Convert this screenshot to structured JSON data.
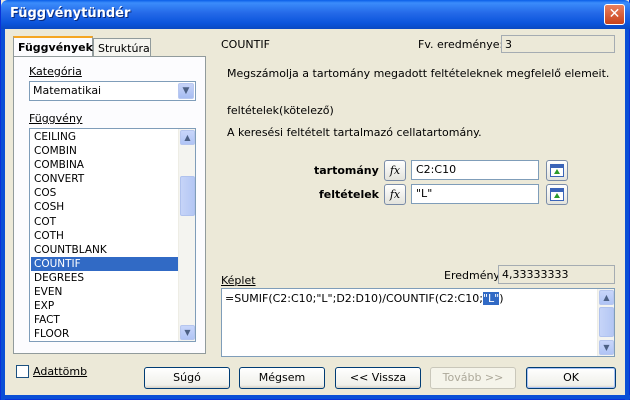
{
  "window": {
    "title": "Függvénytündér"
  },
  "tabs": [
    {
      "label": "Függvények"
    },
    {
      "label": "Struktúra"
    }
  ],
  "category": {
    "label": "Kategória",
    "selected": "Matematikai"
  },
  "function_list": {
    "label": "Függvény",
    "items": [
      "CEILING",
      "COMBIN",
      "COMBINA",
      "CONVERT",
      "COS",
      "COSH",
      "COT",
      "COTH",
      "COUNTBLANK",
      "COUNTIF",
      "DEGREES",
      "EVEN",
      "EXP",
      "FACT",
      "FLOOR"
    ],
    "selected_index": 9
  },
  "function": {
    "name": "COUNTIF",
    "result_label": "Fv. eredménye:",
    "result_value": "3",
    "description": "Megszámolja a tartomány megadott feltételeknek megfelelő elemeit.",
    "param_title": "feltételek(kötelező)",
    "param_description": "A keresési feltételt tartalmazó cellatartomány."
  },
  "args": [
    {
      "label": "tartomány",
      "value": "C2:C10",
      "fx": "fx"
    },
    {
      "label": "feltételek",
      "value": "\"L\"",
      "fx": "fx"
    }
  ],
  "formula": {
    "label": "Képlet",
    "result_label": "Eredmény",
    "result_value": "4,33333333",
    "text_before": "=SUMIF(C2:C10;\"L\";D2:D10)/COUNTIF(C2:C10;",
    "text_highlight": "\"L\"",
    "text_after": ")"
  },
  "array_checkbox": {
    "label": "Adattömb",
    "checked": false
  },
  "buttons": {
    "help": "Súgó",
    "cancel": "Mégsem",
    "back": "<< Vissza",
    "next": "Tovább >>",
    "ok": "OK"
  },
  "colors": {
    "titlebar": "#0A5EE8",
    "selection": "#316AC5",
    "dialog_bg": "#ECE9D8"
  }
}
